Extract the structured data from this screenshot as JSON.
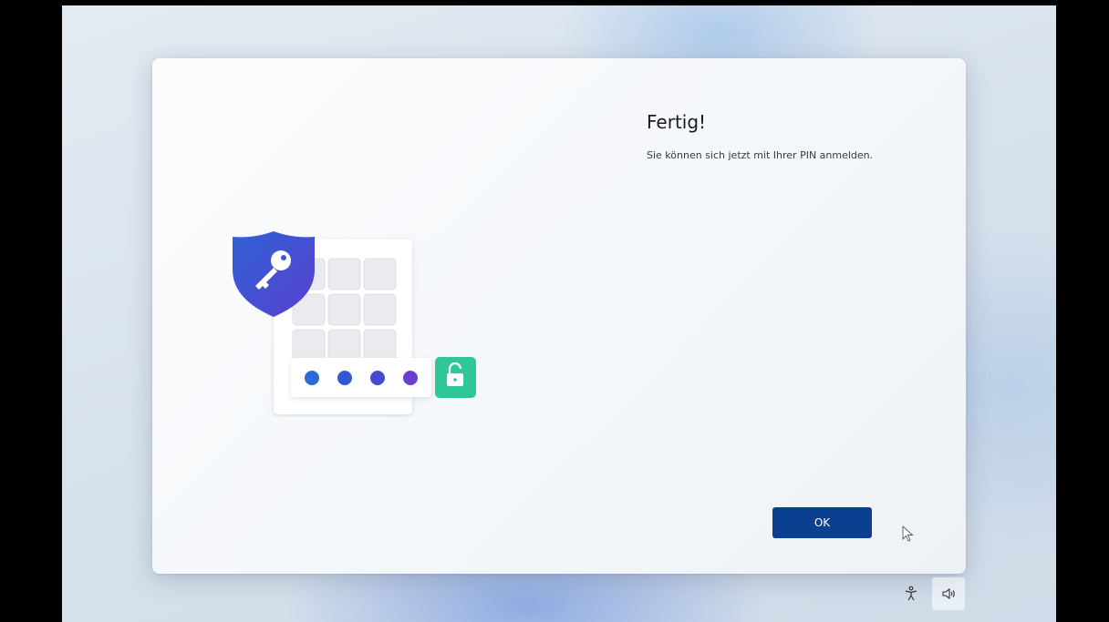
{
  "dialog": {
    "title": "Fertig!",
    "subtitle": "Sie können sich jetzt mit Ihrer PIN anmelden.",
    "ok_label": "OK"
  },
  "illustration": {
    "icons": [
      "shield-key-icon",
      "keypad-icon",
      "pin-dots-icon",
      "unlock-icon"
    ],
    "colors": {
      "shield_top": "#2f62d6",
      "shield_bottom": "#5a3fd0",
      "unlock": "#2fc79a",
      "pin_dots": [
        "#2a6bd8",
        "#3356d2",
        "#4a48cf",
        "#6a3fcf"
      ]
    }
  },
  "tray": {
    "icons": [
      "accessibility-icon",
      "volume-icon"
    ]
  },
  "colors": {
    "accent": "#0b3f8f"
  }
}
